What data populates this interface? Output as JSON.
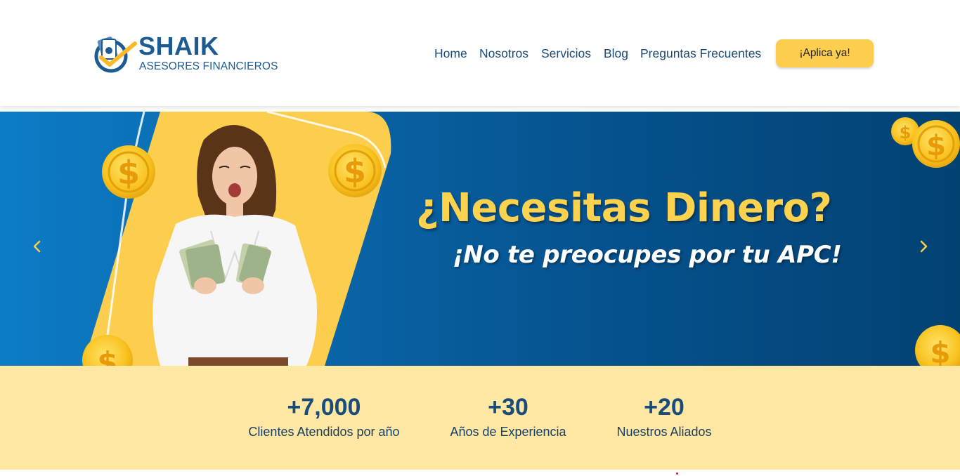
{
  "header": {
    "logo": {
      "title": "SHAIK",
      "subtitle": "ASESORES FINANCIEROS"
    },
    "nav": [
      "Home",
      "Nosotros",
      "Servicios",
      "Blog",
      "Preguntas Frecuentes"
    ],
    "cta_label": "¡Aplica ya!"
  },
  "hero": {
    "title": "¿Necesitas Dinero?",
    "subtitle": "¡No te preocupes por tu APC!",
    "prev_icon": "chevron-left-icon",
    "next_icon": "chevron-right-icon"
  },
  "stats": [
    {
      "value": "+7,000",
      "label": "Clientes Atendidos por año"
    },
    {
      "value": "+30",
      "label": "Años de Experiencia"
    },
    {
      "value": "+20",
      "label": "Nuestros Aliados"
    }
  ],
  "colors": {
    "brand_blue": "#1c5c93",
    "accent_yellow": "#fdcd4d",
    "stats_background": "#fee8a3",
    "hero_blue": "#0a6db5"
  }
}
